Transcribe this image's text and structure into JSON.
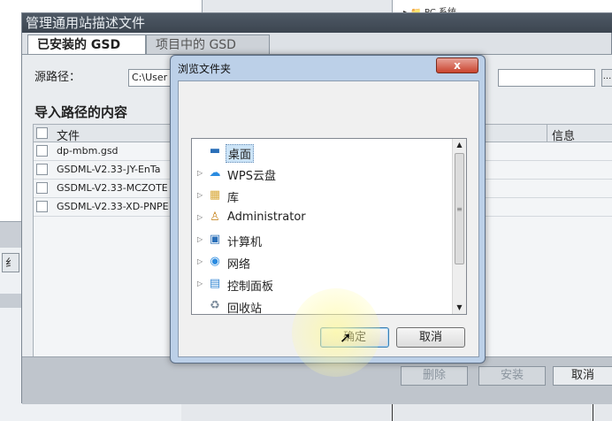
{
  "background": {
    "tree_node": "▸ 📁 PC 系统",
    "left_tab_label": "纟"
  },
  "gsd_dialog": {
    "title": "管理通用站描述文件",
    "tabs": [
      {
        "label": "已安装的 GSD"
      },
      {
        "label": "项目中的 GSD"
      }
    ],
    "source_path_label": "源路径：",
    "source_path_value": "C:\\User",
    "section_title": "导入路径的内容",
    "columns": {
      "file": "文件",
      "info": "信息"
    },
    "rows": [
      {
        "file": "dp-mbm.gsd"
      },
      {
        "file": "GSDML-V2.33-JY-EnTa"
      },
      {
        "file": "GSDML-V2.33-MCZOTE"
      },
      {
        "file": "GSDML-V2.33-XD-PNPE"
      }
    ],
    "buttons": {
      "delete": "删除",
      "install": "安装",
      "cancel": "取消"
    }
  },
  "browse_dialog": {
    "title": "浏览文件夹",
    "close_label": "x",
    "tree": [
      {
        "label": "桌面",
        "icon": "desktop-icon",
        "selected": true
      },
      {
        "label": "WPS云盘",
        "icon": "cloud-icon"
      },
      {
        "label": "库",
        "icon": "library-icon"
      },
      {
        "label": "Administrator",
        "icon": "user-folder-icon"
      },
      {
        "label": "计算机",
        "icon": "computer-icon"
      },
      {
        "label": "网络",
        "icon": "network-icon"
      },
      {
        "label": "控制面板",
        "icon": "control-panel-icon"
      },
      {
        "label": "回收站",
        "icon": "recycle-bin-icon"
      }
    ],
    "ok_label": "确定",
    "cancel_label": "取消"
  }
}
